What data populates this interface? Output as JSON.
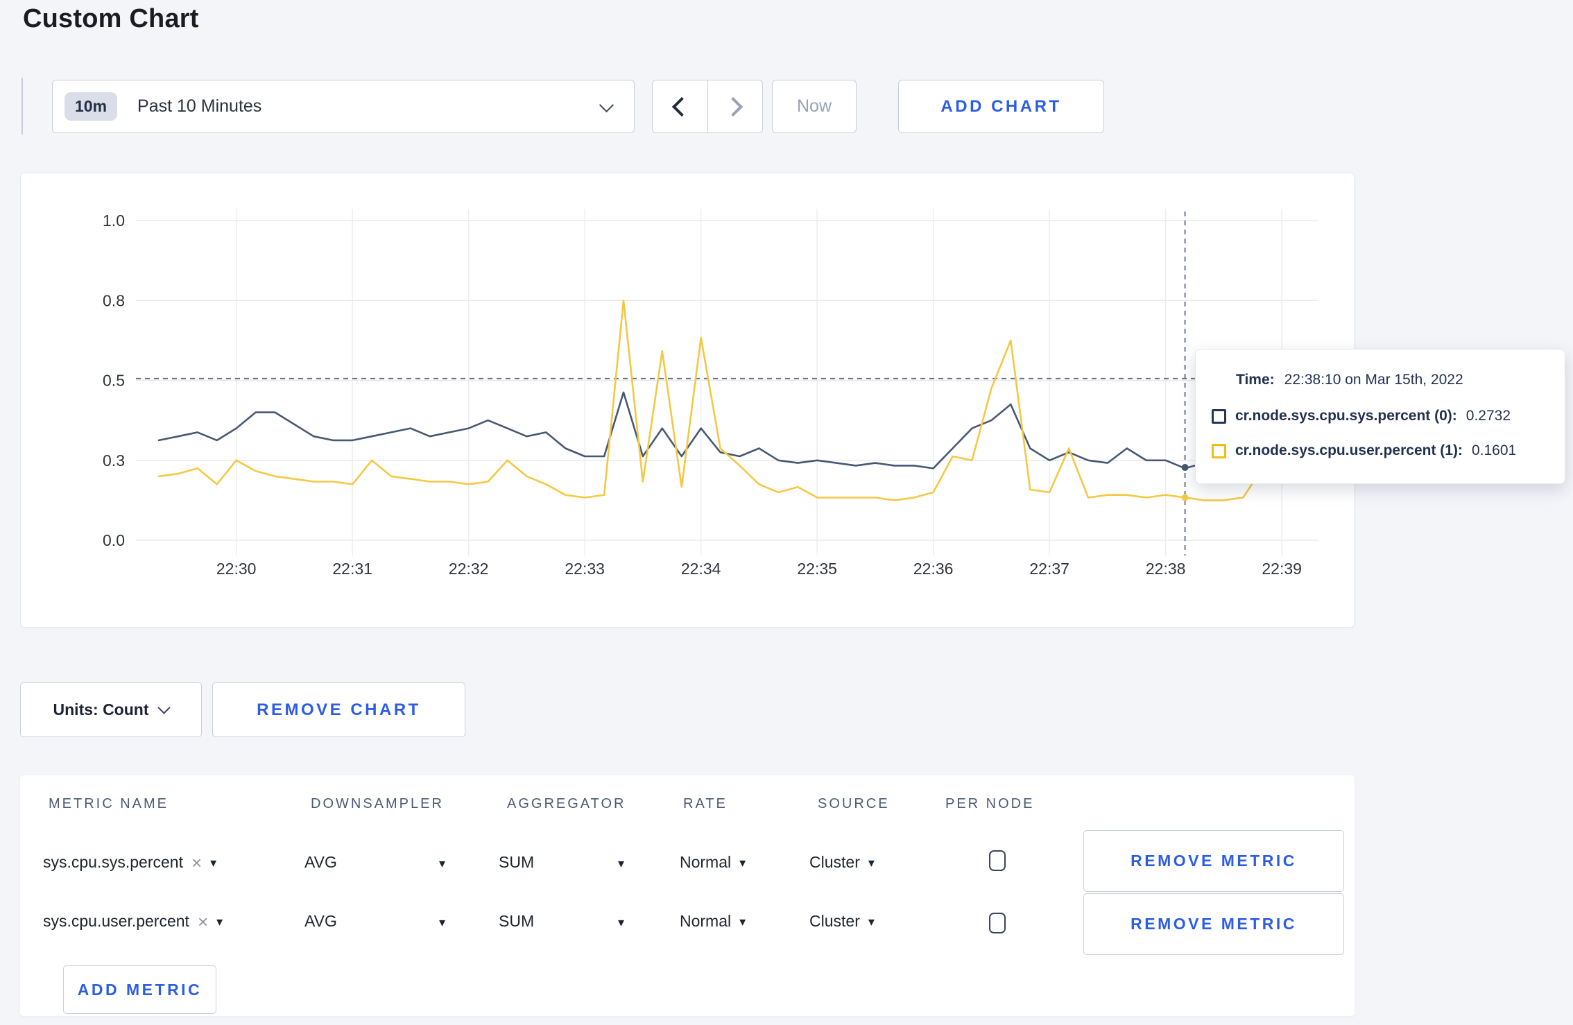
{
  "page": {
    "title": "Custom Chart"
  },
  "icons": {
    "caret": "▾",
    "close": "×"
  },
  "colors": {
    "accent_blue": "#2C5DE5",
    "series_sys": "#475872",
    "series_user": "#F5C843",
    "crosshair": "#5C6B84",
    "page_bg": "#F4F5F9"
  },
  "toolbar": {
    "time_window_badge": "10m",
    "time_window_label": "Past 10 Minutes",
    "now_label": "Now",
    "add_chart_label": "ADD CHART"
  },
  "chart_controls": {
    "units_label": "Units: Count",
    "remove_chart_label": "REMOVE CHART"
  },
  "chart_data": {
    "type": "line",
    "grid": true,
    "y_ticks": [
      0,
      0.3,
      0.5,
      0.8,
      1.0
    ],
    "y_tick_labels": [
      "0.0",
      "0.3",
      "0.5",
      "0.8",
      "1.0"
    ],
    "x_tick_labels": [
      "22:30",
      "22:31",
      "22:32",
      "22:33",
      "22:34",
      "22:35",
      "22:36",
      "22:37",
      "22:38",
      "22:39"
    ],
    "axis_note": "y ticks rendered with equal pixel spacing",
    "x": [
      "22:29:20",
      "22:29:30",
      "22:29:40",
      "22:29:50",
      "22:30:00",
      "22:30:10",
      "22:30:20",
      "22:30:30",
      "22:30:40",
      "22:30:50",
      "22:31:00",
      "22:31:10",
      "22:31:20",
      "22:31:30",
      "22:31:40",
      "22:31:50",
      "22:32:00",
      "22:32:10",
      "22:32:20",
      "22:32:30",
      "22:32:40",
      "22:32:50",
      "22:33:00",
      "22:33:10",
      "22:33:20",
      "22:33:30",
      "22:33:40",
      "22:33:50",
      "22:34:00",
      "22:34:10",
      "22:34:20",
      "22:34:30",
      "22:34:40",
      "22:34:50",
      "22:35:00",
      "22:35:10",
      "22:35:20",
      "22:35:30",
      "22:35:40",
      "22:35:50",
      "22:36:00",
      "22:36:10",
      "22:36:20",
      "22:36:30",
      "22:36:40",
      "22:36:50",
      "22:37:00",
      "22:37:10",
      "22:37:20",
      "22:37:30",
      "22:37:40",
      "22:37:50",
      "22:38:00",
      "22:38:10",
      "22:38:20",
      "22:38:30",
      "22:38:40",
      "22:38:50",
      "22:39:00",
      "22:39:10"
    ],
    "series": [
      {
        "name": "cr.node.sys.cpu.sys.percent",
        "color": "#475872",
        "values": [
          0.35,
          0.36,
          0.37,
          0.35,
          0.38,
          0.42,
          0.42,
          0.39,
          0.36,
          0.35,
          0.35,
          0.36,
          0.37,
          0.38,
          0.36,
          0.37,
          0.38,
          0.4,
          0.38,
          0.36,
          0.37,
          0.33,
          0.31,
          0.31,
          0.47,
          0.31,
          0.38,
          0.31,
          0.38,
          0.32,
          0.31,
          0.33,
          0.3,
          0.29,
          0.3,
          0.29,
          0.28,
          0.29,
          0.28,
          0.28,
          0.27,
          0.33,
          0.38,
          0.4,
          0.44,
          0.33,
          0.3,
          0.32,
          0.3,
          0.29,
          0.33,
          0.3,
          0.3,
          0.27,
          0.29,
          0.3,
          0.32,
          0.31,
          0.3,
          0.31
        ]
      },
      {
        "name": "cr.node.sys.cpu.user.percent",
        "color": "#F5C843",
        "values": [
          0.24,
          0.25,
          0.27,
          0.21,
          0.3,
          0.26,
          0.24,
          0.23,
          0.22,
          0.22,
          0.21,
          0.3,
          0.24,
          0.23,
          0.22,
          0.22,
          0.21,
          0.22,
          0.3,
          0.24,
          0.21,
          0.17,
          0.16,
          0.17,
          0.8,
          0.22,
          0.61,
          0.2,
          0.66,
          0.33,
          0.28,
          0.21,
          0.18,
          0.2,
          0.16,
          0.16,
          0.16,
          0.16,
          0.15,
          0.16,
          0.18,
          0.31,
          0.3,
          0.48,
          0.65,
          0.19,
          0.18,
          0.33,
          0.16,
          0.17,
          0.17,
          0.16,
          0.17,
          0.16,
          0.15,
          0.15,
          0.16,
          0.27,
          0.26,
          0.23
        ]
      }
    ],
    "hover": {
      "time": "22:38:10",
      "index": 53,
      "crosshair_value": 0.507,
      "values": [
        0.2732,
        0.1601
      ]
    }
  },
  "tooltip": {
    "time_label": "Time:",
    "time_value": "22:38:10 on Mar 15th, 2022",
    "rows": [
      {
        "label": "cr.node.sys.cpu.sys.percent (0):",
        "value": "0.2732",
        "color": "#253655"
      },
      {
        "label": "cr.node.sys.cpu.user.percent (1):",
        "value": "0.1601",
        "color": "#F2BC15"
      }
    ]
  },
  "metrics_table": {
    "headers": [
      "METRIC NAME",
      "DOWNSAMPLER",
      "AGGREGATOR",
      "RATE",
      "SOURCE",
      "PER NODE"
    ],
    "rows": [
      {
        "metric": "sys.cpu.sys.percent",
        "downsampler": "AVG",
        "aggregator": "SUM",
        "rate": "Normal",
        "source": "Cluster",
        "per_node_checked": false,
        "remove_label": "REMOVE METRIC"
      },
      {
        "metric": "sys.cpu.user.percent",
        "downsampler": "AVG",
        "aggregator": "SUM",
        "rate": "Normal",
        "source": "Cluster",
        "per_node_checked": false,
        "remove_label": "REMOVE METRIC"
      }
    ],
    "add_metric_label": "ADD METRIC"
  }
}
